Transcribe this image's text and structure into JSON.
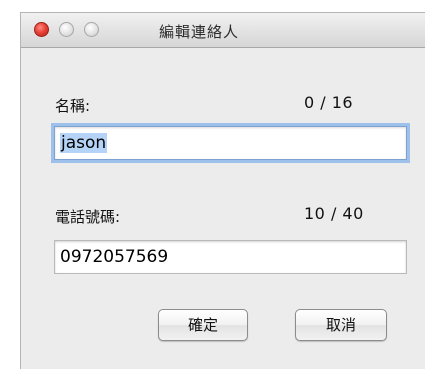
{
  "window": {
    "title": "編輯連絡人"
  },
  "name_field": {
    "label": "名稱:",
    "counter": "0 / 16",
    "value": "jason"
  },
  "phone_field": {
    "label": "電話號碼:",
    "counter": "10 / 40",
    "value": "0972057569"
  },
  "buttons": {
    "confirm_label": "確定",
    "cancel_label": "取消"
  },
  "colors": {
    "close": "#e8443a",
    "focus_ring": "#9ec1ec",
    "selection": "#b5d3f6"
  }
}
